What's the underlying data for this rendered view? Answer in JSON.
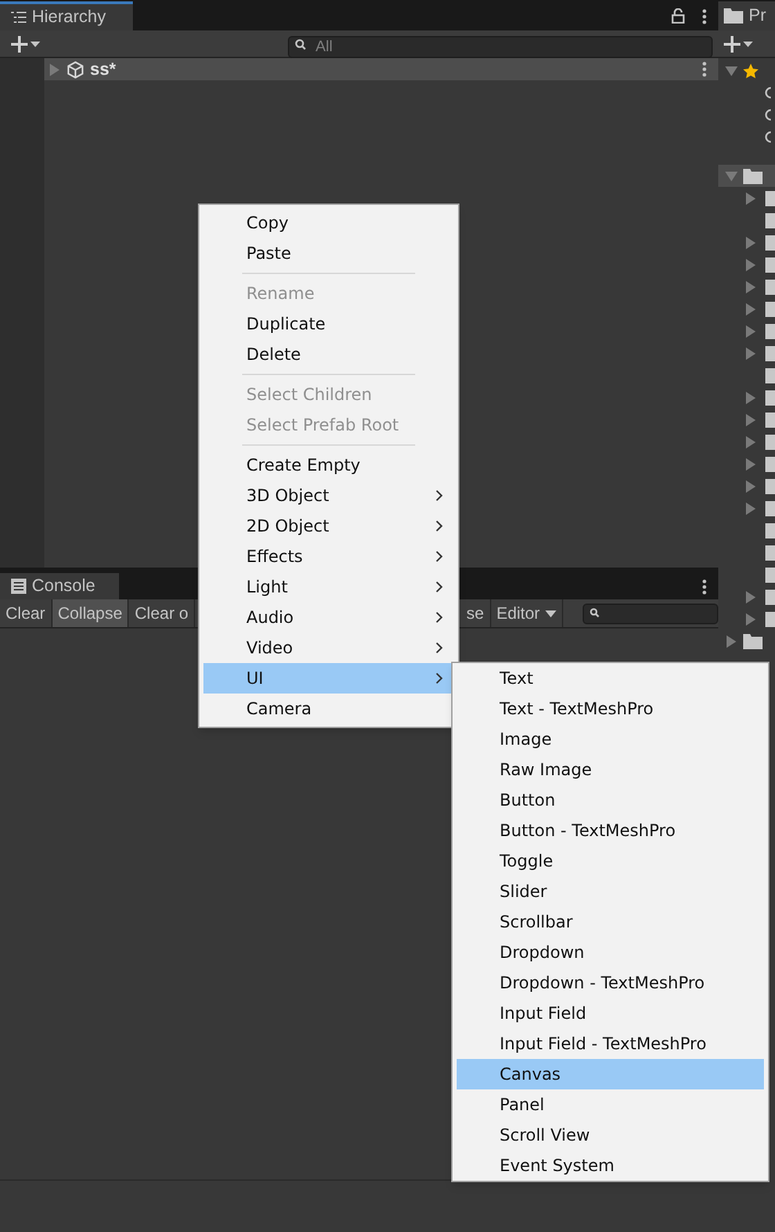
{
  "hierarchy": {
    "tab": "Hierarchy",
    "search": {
      "placeholder": "All"
    },
    "scene": "ss*"
  },
  "console": {
    "tab": "Console",
    "toolbar": [
      {
        "label": "Clear",
        "selected": false
      },
      {
        "label": "Collapse",
        "selected": true
      },
      {
        "label": "Clear o",
        "selected": false
      },
      {
        "label": "se",
        "selected": false
      },
      {
        "label": "Editor",
        "selected": false,
        "dropdown": true
      }
    ]
  },
  "project": {
    "tab": "Pr",
    "favorites": {
      "expanded": true
    },
    "assets": {
      "expanded": true,
      "rows": [
        true,
        false,
        true,
        true,
        true,
        true,
        true,
        true,
        false,
        true,
        true,
        true,
        true,
        true,
        true,
        false,
        false,
        false,
        true,
        true
      ]
    },
    "packages": {
      "expanded": false
    }
  },
  "context_menu": [
    {
      "kind": "item",
      "label": "Copy",
      "disabled": false,
      "submenu": false,
      "selected": false
    },
    {
      "kind": "item",
      "label": "Paste",
      "disabled": false,
      "submenu": false,
      "selected": false
    },
    {
      "kind": "separator"
    },
    {
      "kind": "item",
      "label": "Rename",
      "disabled": true,
      "submenu": false,
      "selected": false
    },
    {
      "kind": "item",
      "label": "Duplicate",
      "disabled": false,
      "submenu": false,
      "selected": false
    },
    {
      "kind": "item",
      "label": "Delete",
      "disabled": false,
      "submenu": false,
      "selected": false
    },
    {
      "kind": "separator"
    },
    {
      "kind": "item",
      "label": "Select Children",
      "disabled": true,
      "submenu": false,
      "selected": false
    },
    {
      "kind": "item",
      "label": "Select Prefab Root",
      "disabled": true,
      "submenu": false,
      "selected": false
    },
    {
      "kind": "separator"
    },
    {
      "kind": "item",
      "label": "Create Empty",
      "disabled": false,
      "submenu": false,
      "selected": false
    },
    {
      "kind": "item",
      "label": "3D Object",
      "disabled": false,
      "submenu": true,
      "selected": false
    },
    {
      "kind": "item",
      "label": "2D Object",
      "disabled": false,
      "submenu": true,
      "selected": false
    },
    {
      "kind": "item",
      "label": "Effects",
      "disabled": false,
      "submenu": true,
      "selected": false
    },
    {
      "kind": "item",
      "label": "Light",
      "disabled": false,
      "submenu": true,
      "selected": false
    },
    {
      "kind": "item",
      "label": "Audio",
      "disabled": false,
      "submenu": true,
      "selected": false
    },
    {
      "kind": "item",
      "label": "Video",
      "disabled": false,
      "submenu": true,
      "selected": false
    },
    {
      "kind": "item",
      "label": "UI",
      "disabled": false,
      "submenu": true,
      "selected": true
    },
    {
      "kind": "item",
      "label": "Camera",
      "disabled": false,
      "submenu": false,
      "selected": false
    }
  ],
  "submenu": [
    {
      "label": "Text",
      "selected": false
    },
    {
      "label": "Text - TextMeshPro",
      "selected": false
    },
    {
      "label": "Image",
      "selected": false
    },
    {
      "label": "Raw Image",
      "selected": false
    },
    {
      "label": "Button",
      "selected": false
    },
    {
      "label": "Button - TextMeshPro",
      "selected": false
    },
    {
      "label": "Toggle",
      "selected": false
    },
    {
      "label": "Slider",
      "selected": false
    },
    {
      "label": "Scrollbar",
      "selected": false
    },
    {
      "label": "Dropdown",
      "selected": false
    },
    {
      "label": "Dropdown - TextMeshPro",
      "selected": false
    },
    {
      "label": "Input Field",
      "selected": false
    },
    {
      "label": "Input Field - TextMeshPro",
      "selected": false
    },
    {
      "label": "Canvas",
      "selected": true
    },
    {
      "label": "Panel",
      "selected": false
    },
    {
      "label": "Scroll View",
      "selected": false
    },
    {
      "label": "Event System",
      "selected": false
    }
  ]
}
